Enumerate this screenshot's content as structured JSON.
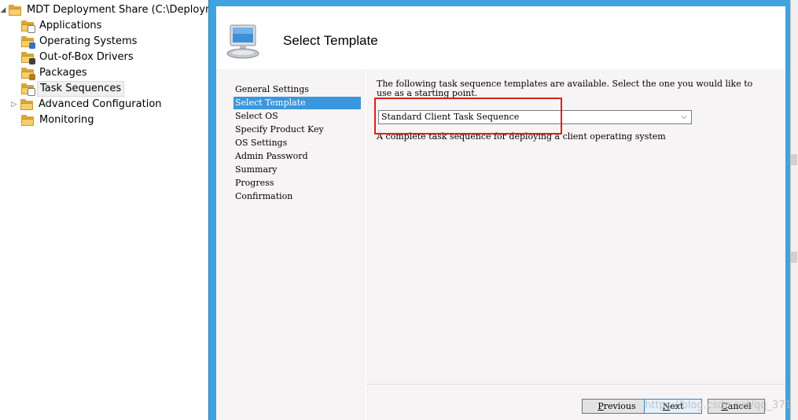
{
  "tree": {
    "root": "MDT Deployment Share (C:\\DeploymentS",
    "items": [
      {
        "label": "Applications",
        "icon": "folder-applications-icon"
      },
      {
        "label": "Operating Systems",
        "icon": "folder-os-icon"
      },
      {
        "label": "Out-of-Box Drivers",
        "icon": "folder-drivers-icon"
      },
      {
        "label": "Packages",
        "icon": "folder-packages-icon"
      },
      {
        "label": "Task Sequences",
        "icon": "folder-tasksequences-icon",
        "selected": true
      },
      {
        "label": "Advanced Configuration",
        "icon": "folder-advanced-icon",
        "expandable": true
      },
      {
        "label": "Monitoring",
        "icon": "folder-monitoring-icon"
      }
    ]
  },
  "dialog": {
    "title": "Select Template",
    "nav": [
      "General Settings",
      "Select Template",
      "Select OS",
      "Specify Product Key",
      "OS Settings",
      "Admin Password",
      "Summary",
      "Progress",
      "Confirmation"
    ],
    "active_nav": "Select Template",
    "intro": "The following task sequence templates are available.  Select the one you would like to use as a starting point.",
    "template_selected": "Standard Client Task Sequence",
    "template_description": "A complete task sequence for deploying a client operating system",
    "buttons": {
      "previous": {
        "pre": "",
        "key": "P",
        "post": "revious"
      },
      "next": {
        "pre": "",
        "key": "N",
        "post": "ext"
      },
      "cancel": {
        "pre": "",
        "key": "C",
        "post": "ancel"
      }
    }
  },
  "watermark": "https://blog.csdn.net/qq_371",
  "colors": {
    "frame": "#3ea3df",
    "nav_active": "#3a96dd",
    "highlight_box": "#e0201c"
  }
}
